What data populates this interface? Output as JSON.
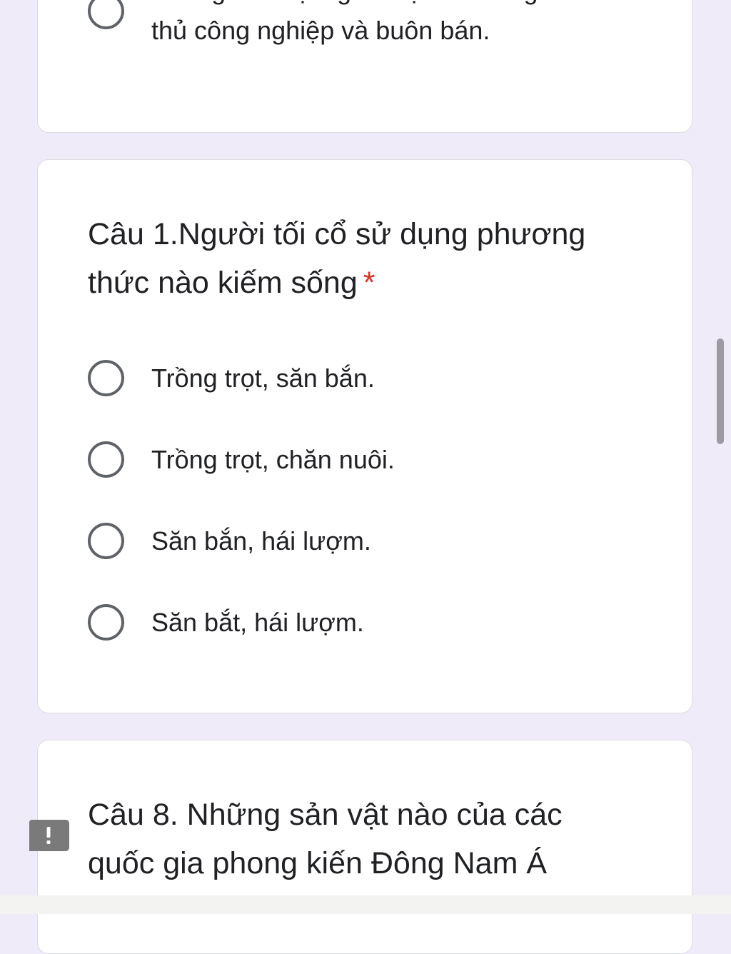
{
  "prev_card": {
    "option_text": "Không đem lại nguồn lợi lớn bằng\nthủ công nghiệp và buôn bán."
  },
  "q1": {
    "title": "Câu 1.Người tối cổ sử dụng phương thức nào kiếm sống",
    "required_marker": "*",
    "options": [
      {
        "label": "Trồng trọt, săn bắn."
      },
      {
        "label": "Trồng trọt, chăn nuôi."
      },
      {
        "label": "Săn bắn, hái lượm."
      },
      {
        "label": "Săn bắt, hái lượm."
      }
    ]
  },
  "q8": {
    "title": "Câu 8. Những sản vật nào của các quốc gia phong kiến Đông Nam Á"
  },
  "icons": {
    "radio": "radio-unchecked-icon",
    "alert": "exclamation-badge-icon"
  },
  "colors": {
    "background": "#f0ebf8",
    "card": "#ffffff",
    "radio_border": "#5f6368",
    "required": "#d93025",
    "text": "#202124"
  }
}
